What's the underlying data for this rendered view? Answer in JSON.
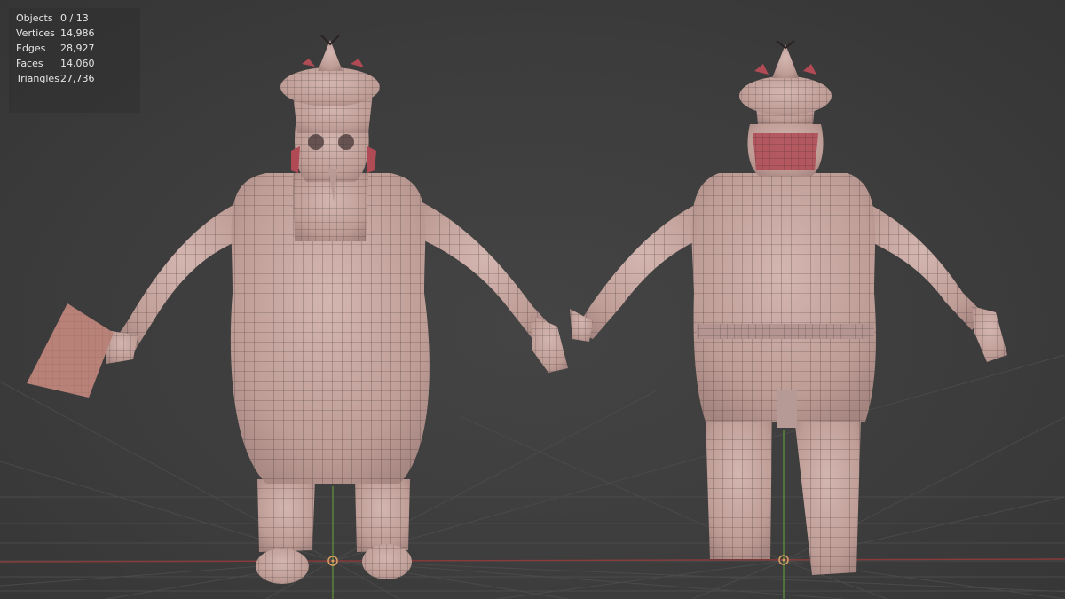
{
  "viewport": {
    "stats": [
      {
        "label": "Objects",
        "value": "0 / 13"
      },
      {
        "label": "Vertices",
        "value": "14,986"
      },
      {
        "label": "Edges",
        "value": "28,927"
      },
      {
        "label": "Faces",
        "value": "14,060"
      },
      {
        "label": "Triangles",
        "value": "27,736"
      }
    ],
    "figures": [
      {
        "view": "front",
        "icon": "chef-character-front-icon"
      },
      {
        "view": "back",
        "icon": "chef-character-back-icon"
      }
    ]
  },
  "colors": {
    "background": "#3d3d3d",
    "grid": "#4a4a4a",
    "x_axis": "#8a3a3a",
    "y_axis": "#5a8a3a",
    "mesh_skin": "#c9a9a4",
    "wire": "#2a2222",
    "hair_accent": "#b04a55",
    "cleaver": "#b98278",
    "origin_marker": "#d9a066"
  }
}
